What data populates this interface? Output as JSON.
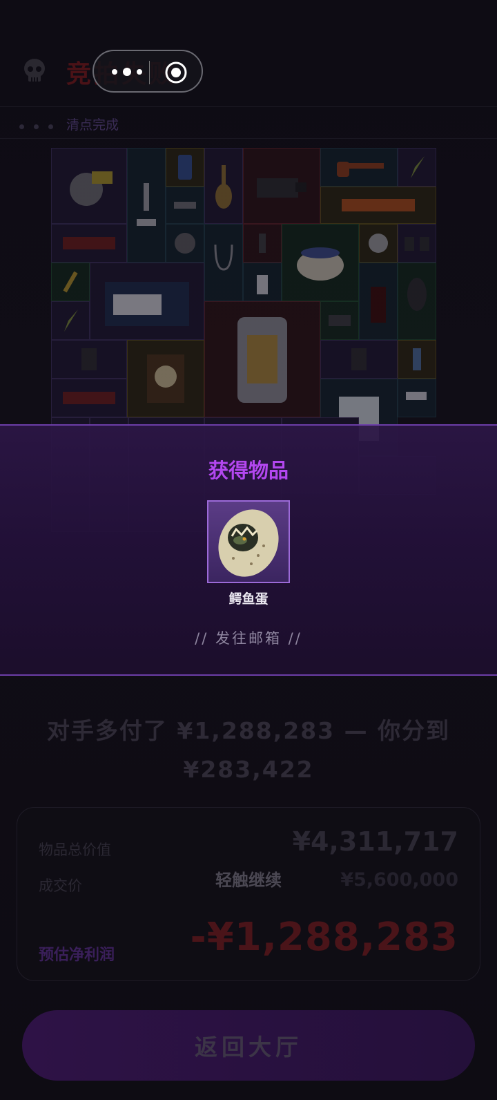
{
  "header": {
    "title": "竞拍失败",
    "status": "清点完成"
  },
  "modal": {
    "title": "获得物品",
    "item_name": "鳄鱼蛋",
    "mail_link": "// 发往邮箱 //"
  },
  "summary": {
    "line1": "对手多付了 ¥1,288,283 — 你分到",
    "line2": "¥283,422"
  },
  "card": {
    "total_value_label": "物品总价值",
    "total_value": "¥4,311,717",
    "deal_price_label": "成交价",
    "deal_price": "¥5,600,000",
    "tap_hint": "轻触继续",
    "profit_label": "预估净利润",
    "profit_value": "-¥1,288,283"
  },
  "back_button": "返回大厅",
  "colors": {
    "accent_purple": "#b347f0",
    "loss_red": "#8a1e28",
    "background": "#0e0c14"
  }
}
